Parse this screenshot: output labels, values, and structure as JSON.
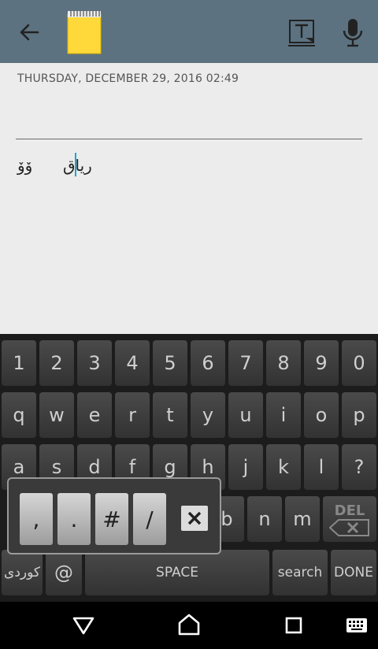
{
  "header": {
    "back_icon": "arrow-left-icon",
    "note_icon": "yellow-note-icon",
    "text_format_icon": "text-format-icon",
    "mic_icon": "microphone-icon",
    "bar_color": "#5c7280"
  },
  "note": {
    "date": "THURSDAY, DECEMBER 29, 2016 02:49",
    "word1": "ۆۆ",
    "word2": "ریاق"
  },
  "keyboard": {
    "row_numbers": [
      "1",
      "2",
      "3",
      "4",
      "5",
      "6",
      "7",
      "8",
      "9",
      "0"
    ],
    "row_q": [
      "q",
      "w",
      "e",
      "r",
      "t",
      "y",
      "u",
      "i",
      "o",
      "p"
    ],
    "row_a": [
      "a",
      "s",
      "d",
      "f",
      "g",
      "h",
      "j",
      "k",
      "l",
      "?"
    ],
    "row_z_visible": [
      "b",
      "n",
      "m"
    ],
    "del_label": "DEL",
    "lang_label": "کوردی",
    "at_label": "@",
    "space_label": "SPACE",
    "search_label": "search",
    "done_label": "DONE"
  },
  "popup": {
    "keys": [
      ",",
      ".",
      "#",
      "/"
    ],
    "close_icon": "close-icon"
  },
  "navbar": {
    "back": "nav-back-icon",
    "home": "nav-home-icon",
    "recents": "nav-recents-icon",
    "keyboard": "keyboard-icon"
  }
}
